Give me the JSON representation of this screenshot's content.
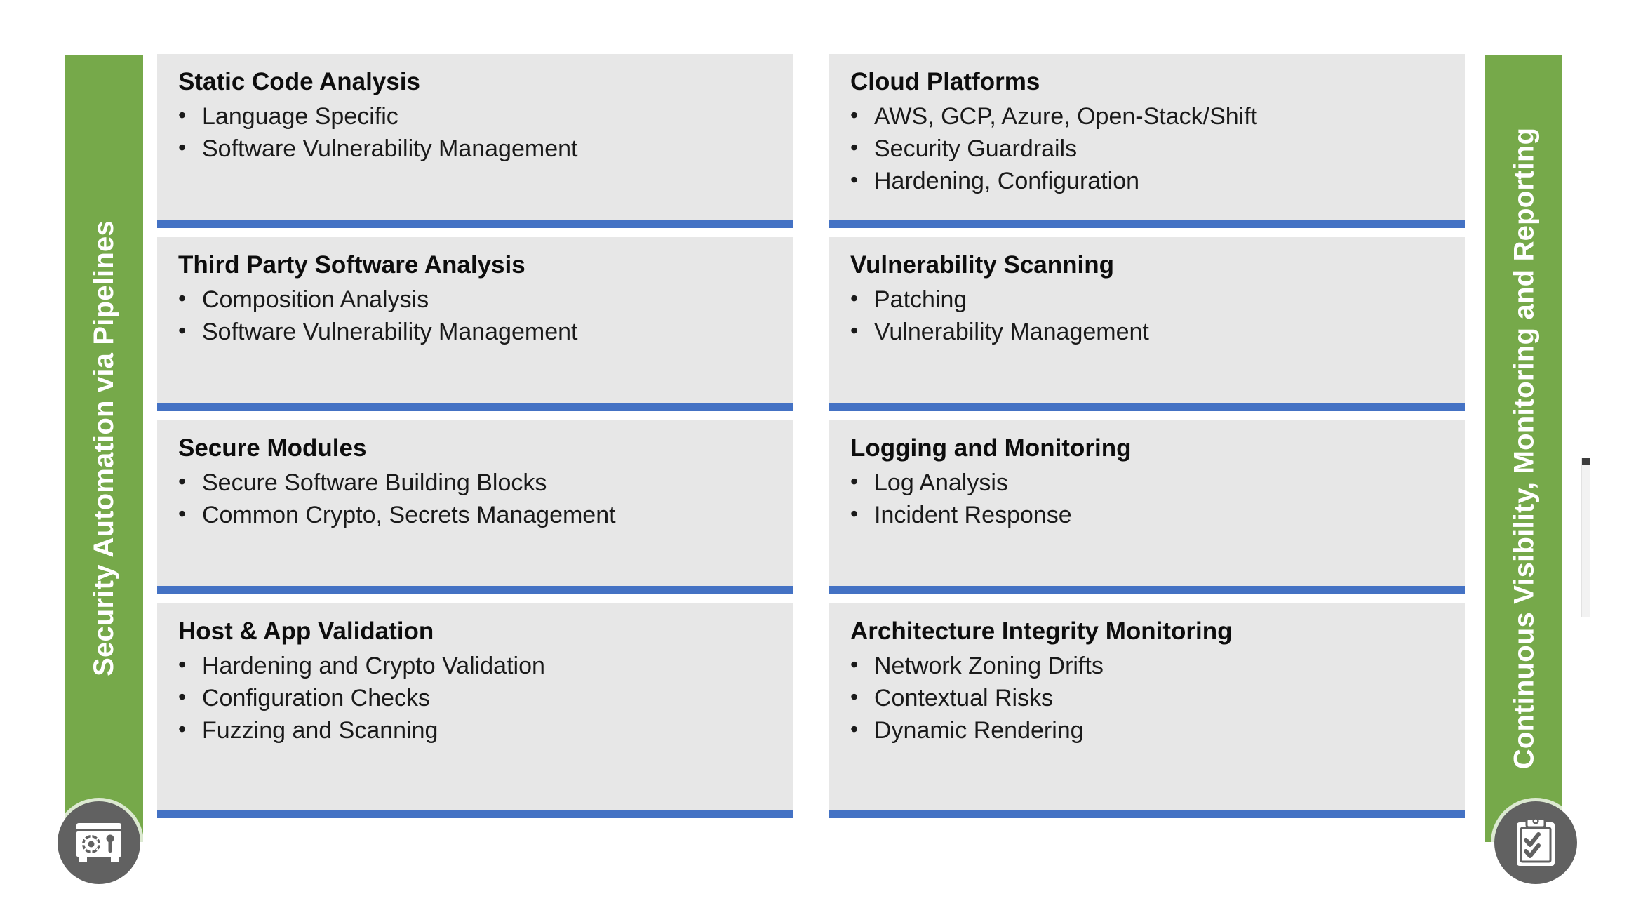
{
  "colors": {
    "green_bar": "#76A94A",
    "card_background": "#E7E7E7",
    "card_underline_blue": "#4472C4",
    "badge_circle": "#616161",
    "page_background": "#FFFFFF",
    "title_text": "#0D0D0D",
    "bullet_text": "#1A1A1A"
  },
  "left_bar": {
    "label": "Security Automation via Pipelines",
    "icon": "safe-vault-icon"
  },
  "right_bar": {
    "label": "Continuous Visibility, Monitoring and Reporting",
    "icon": "clipboard-checklist-icon"
  },
  "columns": [
    {
      "name": "left-column",
      "cards": [
        {
          "title": "Static Code Analysis",
          "bullets": [
            "Language Specific",
            "Software Vulnerability Management"
          ]
        },
        {
          "title": "Third Party Software Analysis",
          "bullets": [
            "Composition Analysis",
            "Software Vulnerability Management"
          ]
        },
        {
          "title": "Secure Modules",
          "bullets": [
            "Secure Software Building Blocks",
            "Common Crypto, Secrets Management"
          ]
        },
        {
          "title": "Host & App Validation",
          "bullets": [
            "Hardening and Crypto Validation",
            "Configuration Checks",
            "Fuzzing and Scanning"
          ]
        }
      ]
    },
    {
      "name": "right-column",
      "cards": [
        {
          "title": "Cloud Platforms",
          "bullets": [
            "AWS, GCP, Azure, Open-Stack/Shift",
            "Security Guardrails",
            "Hardening, Configuration"
          ]
        },
        {
          "title": "Vulnerability Scanning",
          "bullets": [
            "Patching",
            "Vulnerability Management"
          ]
        },
        {
          "title": "Logging and Monitoring",
          "bullets": [
            "Log Analysis",
            "Incident Response"
          ]
        },
        {
          "title": "Architecture Integrity Monitoring",
          "bullets": [
            "Network Zoning Drifts",
            "Contextual Risks",
            "Dynamic Rendering"
          ]
        }
      ]
    }
  ],
  "bullet_glyph": "•"
}
